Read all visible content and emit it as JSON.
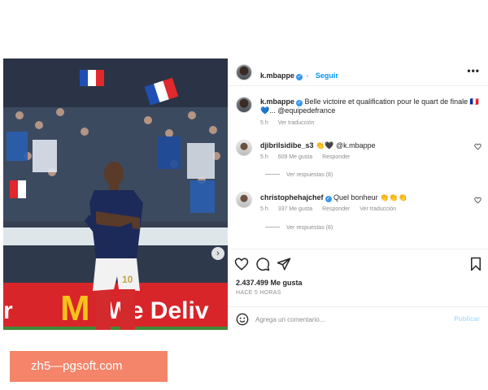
{
  "post": {
    "username": "k.mbappe",
    "follow_label": "Seguir",
    "more_label": "•••"
  },
  "caption": {
    "username": "k.mbappe",
    "text": "Belle victoire et qualification pour le quart de finale 🇫🇷💙... @equipedefrance",
    "time": "5 h",
    "translate_label": "Ver traducción"
  },
  "comments": [
    {
      "username": "djibrilsidibe_s3",
      "text": "👏🖤 @k.mbappe",
      "time": "5 h",
      "likes": "609 Me gusta",
      "reply_label": "Responder",
      "view_replies": "Ver respuestas (8)"
    },
    {
      "username": "christophehajchef",
      "text": "Quel bonheur 👏👏👏",
      "time": "5 h",
      "likes": "337 Me gusta",
      "reply_label": "Responder",
      "translate_label": "Ver traducción",
      "view_replies": "Ver respuestas (8)"
    }
  ],
  "actions": {
    "likes": "2.437.499 Me gusta",
    "time": "HACE 5 HORAS"
  },
  "comment_box": {
    "placeholder": "Agrega un comentario...",
    "post_label": "Publicar"
  },
  "photo": {
    "ad_text": "We Deliv",
    "brand_letter": "M",
    "shirt_number": "10",
    "carousel_index": 1,
    "carousel_count": 2
  },
  "watermark": {
    "text": "zh5—pgsoft.com"
  },
  "colors": {
    "accent": "#0095f6",
    "verified": "#3897f0",
    "ad_red": "#d8252a",
    "pitch": "#3f8a33",
    "watermark": "#f4846a"
  }
}
